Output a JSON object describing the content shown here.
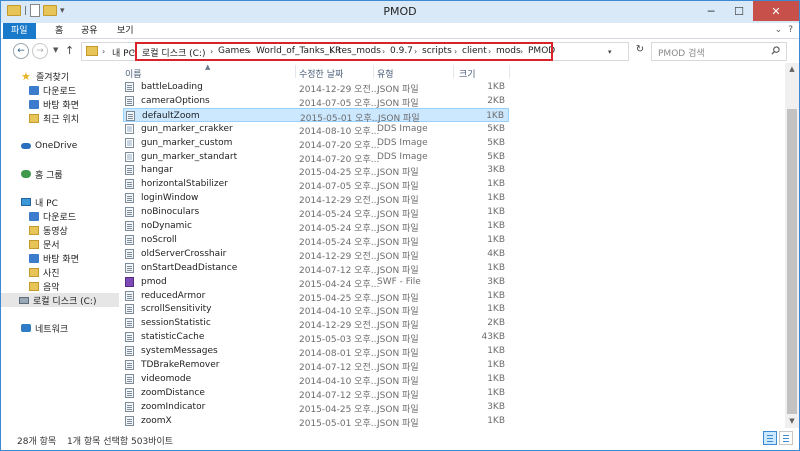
{
  "window": {
    "title": "PMOD"
  },
  "ribbon": {
    "tabs": [
      {
        "label": "파일",
        "active": true
      },
      {
        "label": "홈",
        "active": false
      },
      {
        "label": "공유",
        "active": false
      },
      {
        "label": "보기",
        "active": false
      }
    ]
  },
  "address": {
    "crumbs": [
      "내 PC",
      "로컬 디스크 (C:)",
      "Games",
      "World_of_Tanks_KR",
      "res_mods",
      "0.9.7",
      "scripts",
      "client",
      "mods",
      "PMOD"
    ]
  },
  "search": {
    "placeholder": "PMOD 검색"
  },
  "nav_pane": {
    "items": [
      {
        "label": "즐겨찾기",
        "icon": "star-icon"
      },
      {
        "label": "다운로드",
        "icon": "download-folder-icon"
      },
      {
        "label": "바탕 화면",
        "icon": "desktop-folder-icon"
      },
      {
        "label": "최근 위치",
        "icon": "recent-places-icon"
      },
      {
        "label": "OneDrive",
        "icon": "onedrive-icon"
      },
      {
        "label": "홈 그룹",
        "icon": "homegroup-icon"
      },
      {
        "label": "내 PC",
        "icon": "pc-icon"
      },
      {
        "label": "다운로드",
        "icon": "download-folder-icon"
      },
      {
        "label": "동영상",
        "icon": "videos-folder-icon"
      },
      {
        "label": "문서",
        "icon": "documents-folder-icon"
      },
      {
        "label": "바탕 화면",
        "icon": "desktop-folder-icon"
      },
      {
        "label": "사진",
        "icon": "pictures-folder-icon"
      },
      {
        "label": "음악",
        "icon": "music-folder-icon"
      },
      {
        "label": "로컬 디스크 (C:)",
        "icon": "drive-icon",
        "selected": true
      },
      {
        "label": "네트워크",
        "icon": "network-icon"
      }
    ]
  },
  "columns": {
    "name": "이름",
    "date": "수정한 날짜",
    "type": "유형",
    "size": "크기"
  },
  "files": [
    {
      "name": "battleLoading",
      "date": "2014-12-29 오전...",
      "type": "JSON 파일",
      "size": "1KB",
      "kind": "json"
    },
    {
      "name": "cameraOptions",
      "date": "2014-07-05 오후...",
      "type": "JSON 파일",
      "size": "2KB",
      "kind": "json"
    },
    {
      "name": "defaultZoom",
      "date": "2015-05-01 오후...",
      "type": "JSON 파일",
      "size": "1KB",
      "kind": "json",
      "selected": true
    },
    {
      "name": "gun_marker_crakker",
      "date": "2014-08-10 오후...",
      "type": "DDS Image",
      "size": "5KB",
      "kind": "dds"
    },
    {
      "name": "gun_marker_custom",
      "date": "2014-07-20 오후...",
      "type": "DDS Image",
      "size": "5KB",
      "kind": "dds"
    },
    {
      "name": "gun_marker_standart",
      "date": "2014-07-20 오후...",
      "type": "DDS Image",
      "size": "5KB",
      "kind": "dds"
    },
    {
      "name": "hangar",
      "date": "2015-04-25 오후...",
      "type": "JSON 파일",
      "size": "3KB",
      "kind": "json"
    },
    {
      "name": "horizontalStabilizer",
      "date": "2014-07-05 오후...",
      "type": "JSON 파일",
      "size": "1KB",
      "kind": "json"
    },
    {
      "name": "loginWindow",
      "date": "2014-12-29 오전...",
      "type": "JSON 파일",
      "size": "1KB",
      "kind": "json"
    },
    {
      "name": "noBinoculars",
      "date": "2014-05-24 오후...",
      "type": "JSON 파일",
      "size": "1KB",
      "kind": "json"
    },
    {
      "name": "noDynamic",
      "date": "2014-05-24 오후...",
      "type": "JSON 파일",
      "size": "1KB",
      "kind": "json"
    },
    {
      "name": "noScroll",
      "date": "2014-05-24 오후...",
      "type": "JSON 파일",
      "size": "1KB",
      "kind": "json"
    },
    {
      "name": "oldServerCrosshair",
      "date": "2014-12-29 오전...",
      "type": "JSON 파일",
      "size": "4KB",
      "kind": "json"
    },
    {
      "name": "onStartDeadDistance",
      "date": "2014-07-12 오후...",
      "type": "JSON 파일",
      "size": "1KB",
      "kind": "json"
    },
    {
      "name": "pmod",
      "date": "2015-04-24 오후...",
      "type": "SWF - File",
      "size": "3KB",
      "kind": "swf"
    },
    {
      "name": "reducedArmor",
      "date": "2015-04-25 오후...",
      "type": "JSON 파일",
      "size": "1KB",
      "kind": "json"
    },
    {
      "name": "scrollSensitivity",
      "date": "2014-04-10 오후...",
      "type": "JSON 파일",
      "size": "1KB",
      "kind": "json"
    },
    {
      "name": "sessionStatistic",
      "date": "2014-12-29 오전...",
      "type": "JSON 파일",
      "size": "2KB",
      "kind": "json"
    },
    {
      "name": "statisticCache",
      "date": "2015-05-03 오후...",
      "type": "JSON 파일",
      "size": "43KB",
      "kind": "json"
    },
    {
      "name": "systemMessages",
      "date": "2014-08-01 오후...",
      "type": "JSON 파일",
      "size": "1KB",
      "kind": "json"
    },
    {
      "name": "TDBrakeRemover",
      "date": "2014-07-12 오전...",
      "type": "JSON 파일",
      "size": "1KB",
      "kind": "json"
    },
    {
      "name": "videomode",
      "date": "2014-04-10 오후...",
      "type": "JSON 파일",
      "size": "1KB",
      "kind": "json"
    },
    {
      "name": "zoomDistance",
      "date": "2014-07-12 오후...",
      "type": "JSON 파일",
      "size": "1KB",
      "kind": "json"
    },
    {
      "name": "zoomIndicator",
      "date": "2015-04-25 오후...",
      "type": "JSON 파일",
      "size": "3KB",
      "kind": "json"
    },
    {
      "name": "zoomX",
      "date": "2015-05-01 오후...",
      "type": "JSON 파일",
      "size": "1KB",
      "kind": "json"
    }
  ],
  "status": {
    "item_count": "28개 항목",
    "selection": "1개 항목 선택함 503바이트"
  },
  "colors": {
    "accent": "#1979ca",
    "highlight": "#d9232a",
    "selected_row": "#cce8ff"
  }
}
